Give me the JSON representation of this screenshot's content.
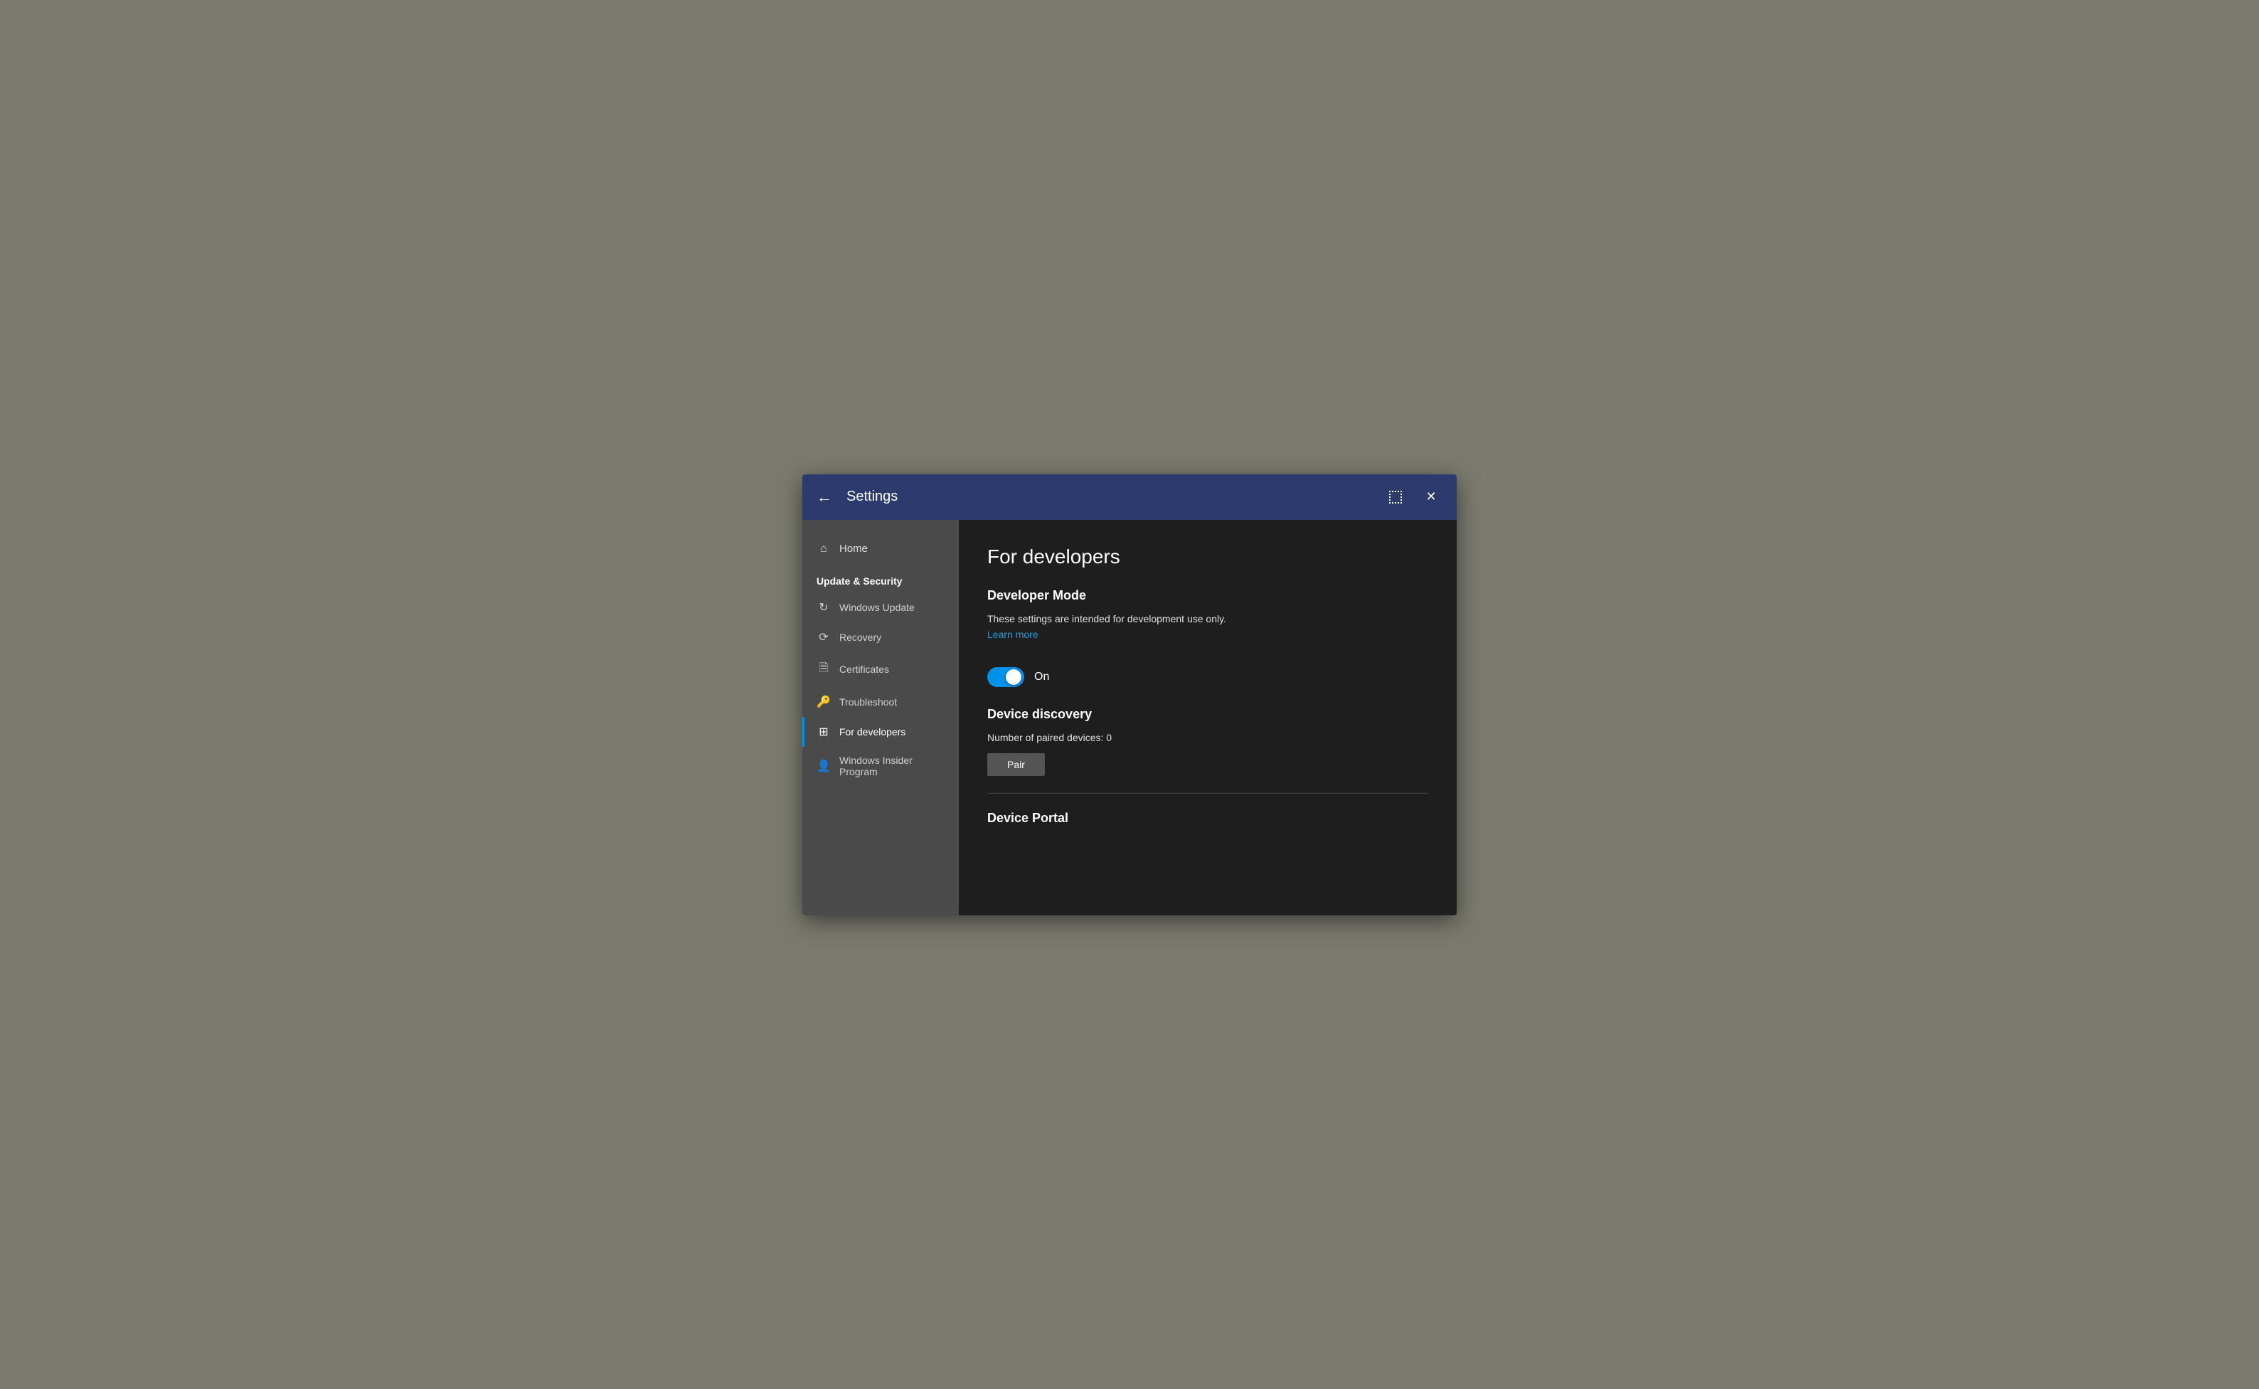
{
  "titlebar": {
    "title": "Settings",
    "back_label": "←",
    "close_label": "✕"
  },
  "sidebar": {
    "home_label": "Home",
    "section_title": "Update & Security",
    "items": [
      {
        "id": "windows-update",
        "label": "Windows Update",
        "icon": "↻"
      },
      {
        "id": "recovery",
        "label": "Recovery",
        "icon": "⏱"
      },
      {
        "id": "certificates",
        "label": "Certificates",
        "icon": "📋"
      },
      {
        "id": "troubleshoot",
        "label": "Troubleshoot",
        "icon": "🔑"
      },
      {
        "id": "for-developers",
        "label": "For developers",
        "icon": "⊞",
        "active": true
      },
      {
        "id": "windows-insider",
        "label": "Windows Insider Program",
        "icon": "👤"
      }
    ]
  },
  "main": {
    "page_title": "For developers",
    "developer_mode": {
      "section_title": "Developer Mode",
      "description": "These settings are intended for development use only.",
      "learn_more": "Learn more",
      "toggle_state": "On"
    },
    "device_discovery": {
      "section_title": "Device discovery",
      "paired_devices_text": "Number of paired devices: 0",
      "pair_button_label": "Pair"
    },
    "device_portal": {
      "section_title": "Device Portal"
    }
  }
}
